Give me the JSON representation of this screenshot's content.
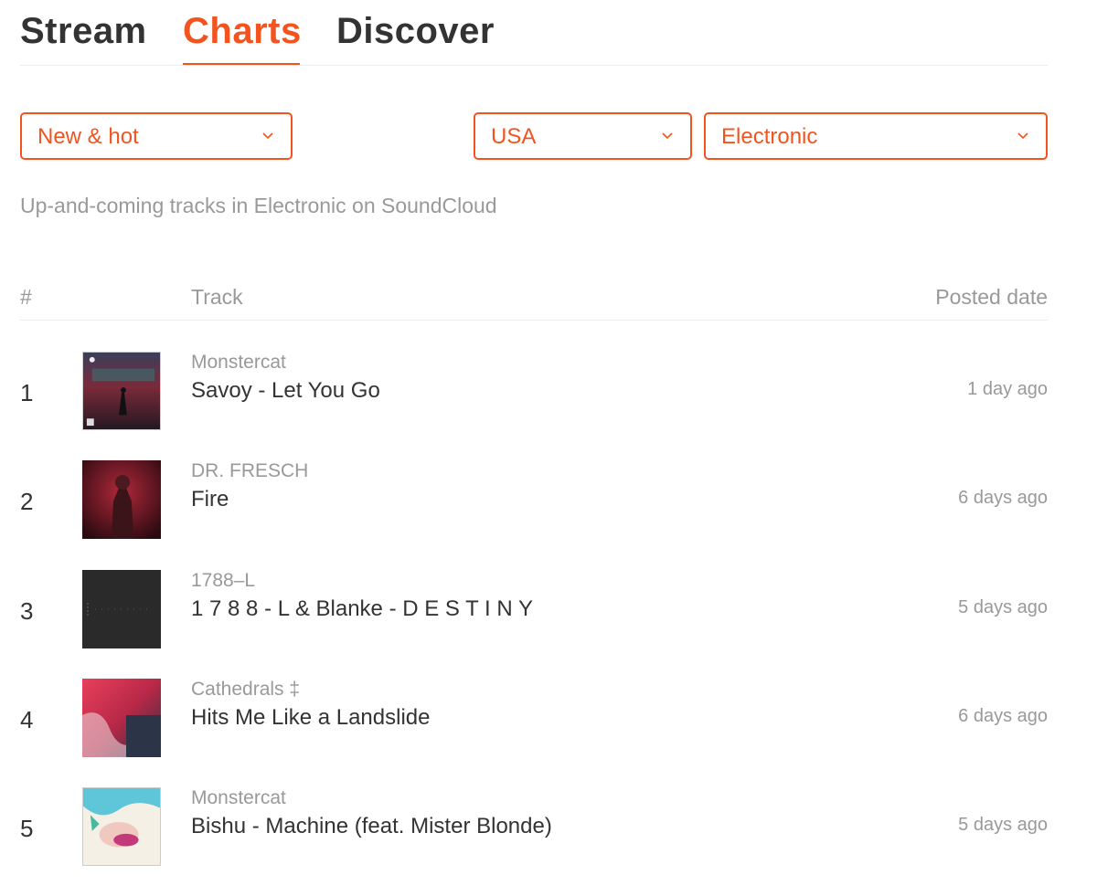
{
  "colors": {
    "accent": "#f3541f",
    "text": "#333333",
    "muted": "#999999"
  },
  "nav": {
    "tabs": [
      {
        "label": "Stream"
      },
      {
        "label": "Charts",
        "active": true
      },
      {
        "label": "Discover"
      }
    ]
  },
  "filters": {
    "chart_type": {
      "value": "New & hot",
      "icon": "chevron-down-icon"
    },
    "country": {
      "value": "USA",
      "icon": "chevron-down-icon"
    },
    "genre": {
      "value": "Electronic",
      "icon": "chevron-down-icon"
    }
  },
  "subtitle": "Up-and-coming tracks in Electronic on SoundCloud",
  "table": {
    "headers": {
      "rank": "#",
      "track": "Track",
      "date": "Posted date"
    },
    "rows": [
      {
        "rank": "1",
        "artist": "Monstercat",
        "title": "Savoy - Let You Go",
        "date": "1 day ago"
      },
      {
        "rank": "2",
        "artist": "DR. FRESCH",
        "title": "Fire",
        "date": "6 days ago"
      },
      {
        "rank": "3",
        "artist": "1788–L",
        "title": "1 7 8 8 - L & Blanke - D E S T I N Y",
        "date": "5 days ago"
      },
      {
        "rank": "4",
        "artist": "Cathedrals ‡",
        "title": "Hits Me Like a Landslide",
        "date": "6 days ago"
      },
      {
        "rank": "5",
        "artist": "Monstercat",
        "title": "Bishu - Machine (feat. Mister Blonde)",
        "date": "5 days ago"
      }
    ]
  }
}
